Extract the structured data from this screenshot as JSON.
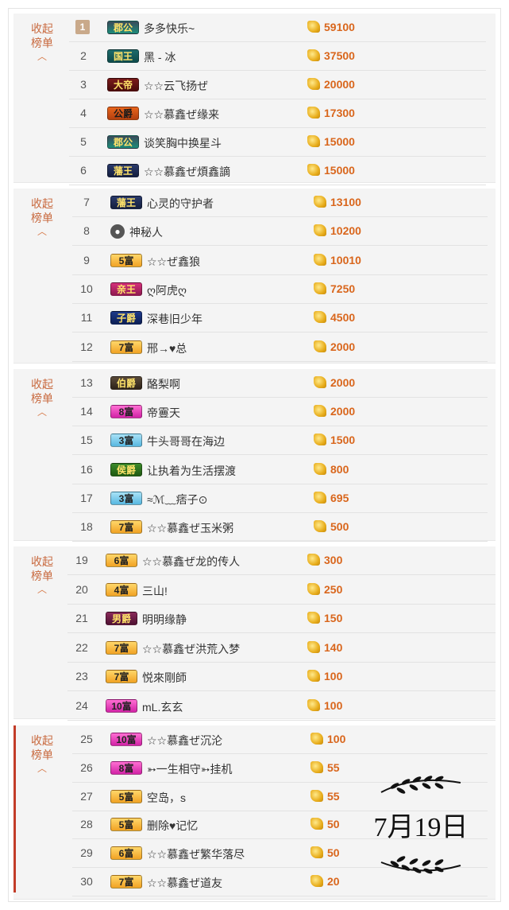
{
  "groups": [
    {
      "collapse_label": "收起\n榜单",
      "rows": [
        {
          "rank": "1",
          "badge": "郡公",
          "badge_class": "b-jungong",
          "name": "多多快乐~",
          "score": "59100"
        },
        {
          "rank": "2",
          "badge": "国王",
          "badge_class": "b-guowang",
          "name": "黑 - 冰",
          "score": "37500"
        },
        {
          "rank": "3",
          "badge": "大帝",
          "badge_class": "b-dadi",
          "name": "☆☆云飞扬ぜ",
          "score": "20000"
        },
        {
          "rank": "4",
          "badge": "公爵",
          "badge_class": "b-gongjue",
          "name": "☆☆慕鑫ぜ缘来",
          "score": "17300"
        },
        {
          "rank": "5",
          "badge": "郡公",
          "badge_class": "b-jungong",
          "name": "谈笑胸中换星斗",
          "score": "15000"
        },
        {
          "rank": "6",
          "badge": "藩王",
          "badge_class": "b-fanwang",
          "name": "☆☆慕鑫ぜ煩鑫謫",
          "score": "15000"
        }
      ]
    },
    {
      "collapse_label": "收起\n榜单",
      "rows": [
        {
          "rank": "7",
          "badge": "藩王",
          "badge_class": "b-fanwang",
          "name": "心灵的守护者",
          "score": "13100"
        },
        {
          "rank": "8",
          "badge": "",
          "badge_class": "mystery",
          "name": "神秘人",
          "score": "10200"
        },
        {
          "rank": "9",
          "badge": "5富",
          "badge_class": "b-fu-orange",
          "name": "☆☆ぜ鑫狼",
          "score": "10010"
        },
        {
          "rank": "10",
          "badge": "亲王",
          "badge_class": "b-qinwang",
          "name": "ღ阿虎ღ",
          "score": "7250"
        },
        {
          "rank": "11",
          "badge": "子爵",
          "badge_class": "b-zijue",
          "name": "深巷旧少年",
          "score": "4500"
        },
        {
          "rank": "12",
          "badge": "7富",
          "badge_class": "b-fu-orange",
          "name": "邢→♥总",
          "score": "2000"
        }
      ]
    },
    {
      "collapse_label": "收起\n榜单",
      "rows": [
        {
          "rank": "13",
          "badge": "伯爵",
          "badge_class": "b-bojue",
          "name": "酪梨啊",
          "score": "2000"
        },
        {
          "rank": "14",
          "badge": "8富",
          "badge_class": "b-fu-pink",
          "name": "帝霻天",
          "score": "2000"
        },
        {
          "rank": "15",
          "badge": "3富",
          "badge_class": "b-fu-blue",
          "name": "牛头哥哥在海边",
          "score": "1500"
        },
        {
          "rank": "16",
          "badge": "侯爵",
          "badge_class": "b-houjue",
          "name": "让执着为生活摆渡",
          "score": "800"
        },
        {
          "rank": "17",
          "badge": "3富",
          "badge_class": "b-fu-blue",
          "name": "≈ℳ﹏痞子⊙",
          "score": "695"
        },
        {
          "rank": "18",
          "badge": "7富",
          "badge_class": "b-fu-orange",
          "name": "☆☆慕鑫ぜ玉米粥",
          "score": "500"
        }
      ]
    },
    {
      "collapse_label": "收起\n榜单",
      "rows": [
        {
          "rank": "19",
          "badge": "6富",
          "badge_class": "b-fu-orange",
          "name": "☆☆慕鑫ぜ龙的传人",
          "score": "300"
        },
        {
          "rank": "20",
          "badge": "4富",
          "badge_class": "b-fu-orange",
          "name": "三山!",
          "score": "250"
        },
        {
          "rank": "21",
          "badge": "男爵",
          "badge_class": "b-nanjue",
          "name": "明明缘静",
          "score": "150"
        },
        {
          "rank": "22",
          "badge": "7富",
          "badge_class": "b-fu-orange",
          "name": "☆☆慕鑫ぜ洪荒入梦",
          "score": "140"
        },
        {
          "rank": "23",
          "badge": "7富",
          "badge_class": "b-fu-orange",
          "name": "悦來剛師",
          "score": "100"
        },
        {
          "rank": "24",
          "badge": "10富",
          "badge_class": "b-fu-pink",
          "name": "mL.玄玄",
          "score": "100"
        }
      ]
    },
    {
      "collapse_label": "收起\n榜单",
      "rows": [
        {
          "rank": "25",
          "badge": "10富",
          "badge_class": "b-fu-pink",
          "name": "☆☆慕鑫ぜ沉沦",
          "score": "100"
        },
        {
          "rank": "26",
          "badge": "8富",
          "badge_class": "b-fu-pink",
          "name": "➳一生相守➳挂机",
          "score": "55"
        },
        {
          "rank": "27",
          "badge": "5富",
          "badge_class": "b-fu-orange",
          "name": "空岛，s",
          "score": "55"
        },
        {
          "rank": "28",
          "badge": "5富",
          "badge_class": "b-fu-orange",
          "name": "删除♥记忆",
          "score": "50"
        },
        {
          "rank": "29",
          "badge": "6富",
          "badge_class": "b-fu-orange",
          "name": "☆☆慕鑫ぜ繁华落尽",
          "score": "50"
        },
        {
          "rank": "30",
          "badge": "7富",
          "badge_class": "b-fu-orange",
          "name": "☆☆慕鑫ぜ道友",
          "score": "20"
        }
      ]
    }
  ],
  "date_stamp": "7月19日",
  "colors": {
    "accent": "#d9661c",
    "collapse_text": "#c8693e",
    "group_bg": "#f4f4f4"
  }
}
